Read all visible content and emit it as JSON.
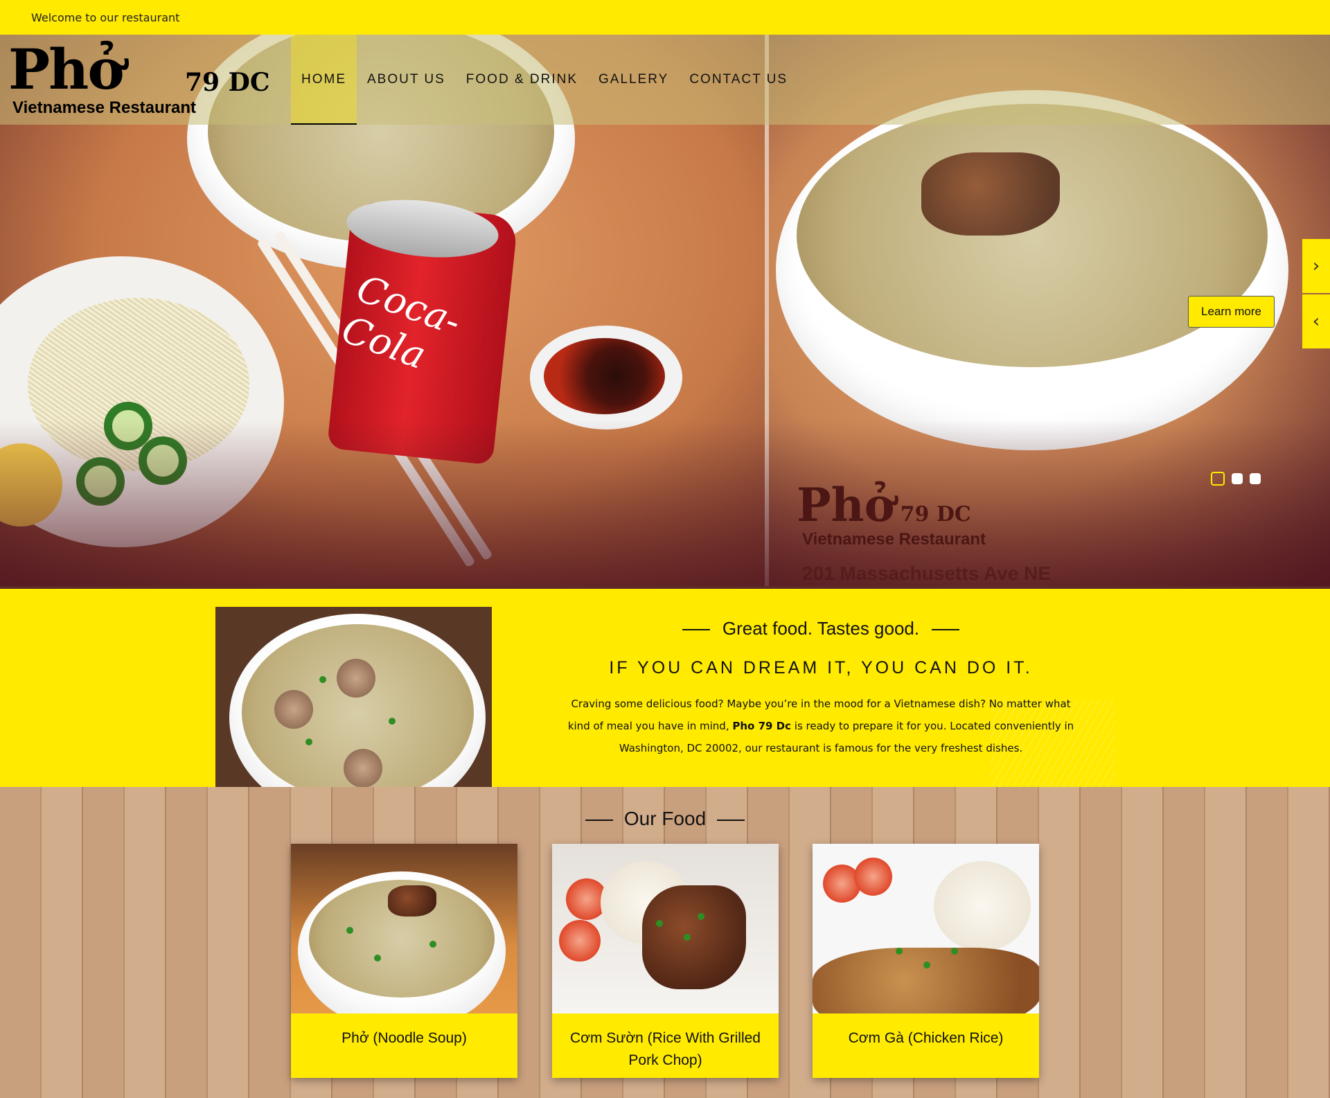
{
  "topbar": {
    "welcome": "Welcome to our restaurant"
  },
  "brand": {
    "name": "Phở",
    "number": "79 DC",
    "subtitle": "Vietnamese Restaurant"
  },
  "nav": {
    "items": [
      {
        "label": "HOME",
        "active": true
      },
      {
        "label": "ABOUT US",
        "active": false
      },
      {
        "label": "FOOD & DRINK",
        "active": false
      },
      {
        "label": "GALLERY",
        "active": false
      },
      {
        "label": "CONTACT US",
        "active": false
      }
    ]
  },
  "hero": {
    "learn_more": "Learn more",
    "next_icon": "chevron-right-icon",
    "prev_icon": "chevron-left-icon",
    "slides": 3,
    "active_slide": 1,
    "can_text": "Coca-Cola",
    "photo_logo": {
      "name": "Phở",
      "number": "79 DC",
      "subtitle": "Vietnamese Restaurant",
      "address": "201 Massachusetts Ave NE"
    }
  },
  "intro": {
    "heading": "Great food. Tastes good.",
    "tagline": "IF YOU CAN DREAM IT, YOU CAN DO IT.",
    "text_before": "Craving some delicious food? Maybe you’re in the mood for a Vietnamese dish? No matter what kind of meal you have in mind, ",
    "text_bold": "Pho 79 Dc",
    "text_after": " is ready to prepare it for you. Located conveniently in Washington, DC 20002, our restaurant is famous for the very freshest dishes."
  },
  "food": {
    "title": "Our Food",
    "items": [
      {
        "label": "Phở (Noodle Soup)"
      },
      {
        "label": "Cơm Sườn (Rice With Grilled Pork Chop)"
      },
      {
        "label": "Cơm Gà (Chicken Rice)"
      }
    ]
  },
  "colors": {
    "accent": "#ffea00",
    "dark": "#5d2a28"
  }
}
